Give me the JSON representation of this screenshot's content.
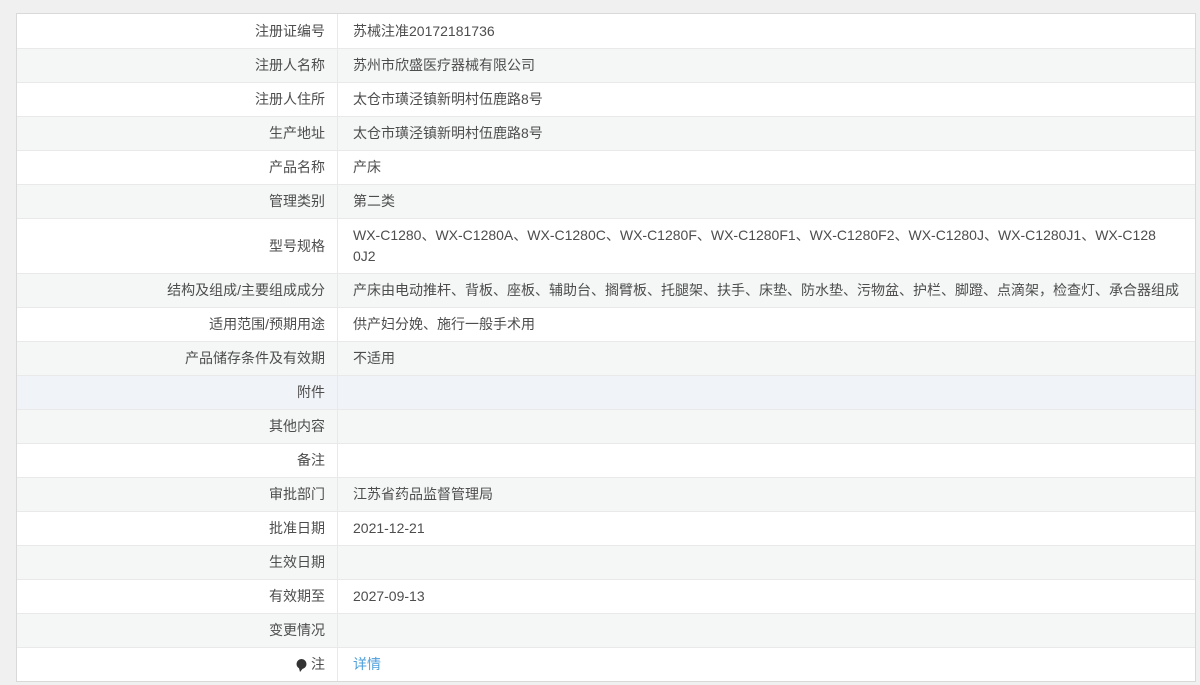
{
  "page": {
    "background_color": "#f0f0f0"
  },
  "colors": {
    "link": "#4d9fdb",
    "stripe": "#f5f6f6",
    "highlight_stripe": "#f0f3f8",
    "outer_border": "#d9d9d9",
    "inner_border": "#e9e9e9",
    "text": "#4d4d4d"
  },
  "table": {
    "rows": [
      {
        "label": "注册证编号",
        "value": "苏械注准20172181736"
      },
      {
        "label": "注册人名称",
        "value": "苏州市欣盛医疗器械有限公司"
      },
      {
        "label": "注册人住所",
        "value": "太仓市璜泾镇新明村伍鹿路8号"
      },
      {
        "label": "生产地址",
        "value": "太仓市璜泾镇新明村伍鹿路8号"
      },
      {
        "label": "产品名称",
        "value": "产床"
      },
      {
        "label": "管理类别",
        "value": "第二类"
      },
      {
        "label": "型号规格",
        "value": "WX-C1280、WX-C1280A、WX-C1280C、WX-C1280F、WX-C1280F1、WX-C1280F2、WX-C1280J、WX-C1280J1、WX-C1280J2"
      },
      {
        "label": "结构及组成/主要组成成分",
        "value": "产床由电动推杆、背板、座板、辅助台、搁臂板、托腿架、扶手、床垫、防水垫、污物盆、护栏、脚蹬、点滴架，检查灯、承合器组成"
      },
      {
        "label": "适用范围/预期用途",
        "value": "供产妇分娩、施行一般手术用"
      },
      {
        "label": "产品储存条件及有效期",
        "value": "不适用"
      },
      {
        "label": "附件",
        "value": ""
      },
      {
        "label": "其他内容",
        "value": ""
      },
      {
        "label": "备注",
        "value": ""
      },
      {
        "label": "审批部门",
        "value": "江苏省药品监督管理局"
      },
      {
        "label": "批准日期",
        "value": "2021-12-21"
      },
      {
        "label": "生效日期",
        "value": ""
      },
      {
        "label": "有效期至",
        "value": "2027-09-13"
      },
      {
        "label": "变更情况",
        "value": ""
      },
      {
        "label": "注",
        "value": "详情",
        "is_link": true,
        "icon": "note-icon"
      }
    ]
  }
}
